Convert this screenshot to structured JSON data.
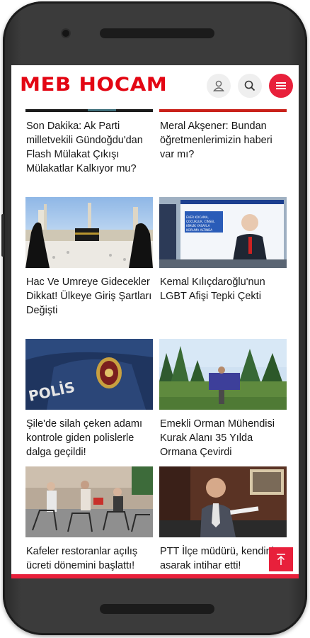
{
  "header": {
    "logo": "MEB HOCAM",
    "icons": [
      "user-icon",
      "search-icon",
      "menu-icon"
    ]
  },
  "articles": [
    {
      "title": "Son Dakika: Ak Parti milletvekili Gündoğdu'dan Flash Mülakat Çıkışı Mülakatlar Kalkıyor mu?"
    },
    {
      "title": "Meral Akşener: Bundan öğretmenlerimizin haberi var mı?"
    },
    {
      "title": "Hac Ve Umreye Gidecekler Dikkat! Ülkeye Giriş Şartları Değişti"
    },
    {
      "title": "Kemal Kılıçdaroğlu'nun LGBT Afişi Tepki Çekti",
      "poster_text": "EVER KOCAMA, ÇOCUKLUK, CİNSEL KİMLİK YASAYLA KORUMA ALTINDA OLACAK"
    },
    {
      "title": "Şile'de silah çeken adamı kontrole giden polislerle dalga geçildi!",
      "badge_text": "POLİS"
    },
    {
      "title": "Emekli Orman Mühendisi Kurak Alanı 35 Yılda Ormana Çevirdi"
    },
    {
      "title": "Kafeler restoranlar açılış ücreti dönemini başlattı!"
    },
    {
      "title": "PTT İlçe müdürü, kendini asarak intihar etti!"
    }
  ],
  "colors": {
    "brand": "#e30613",
    "accent": "#e8203b"
  }
}
